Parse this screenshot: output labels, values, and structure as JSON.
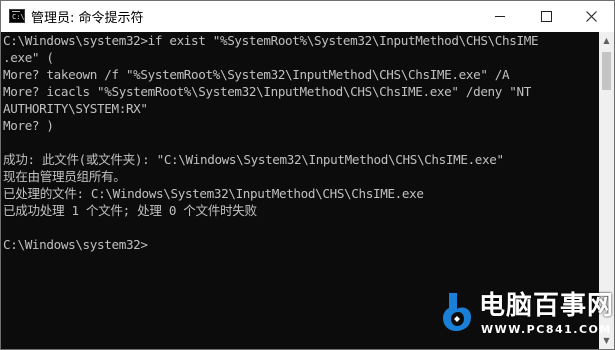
{
  "window": {
    "title": "管理员: 命令提示符",
    "icon_text": "C:\\_"
  },
  "controls": {
    "minimize_icon": "minimize-icon",
    "maximize_icon": "maximize-icon",
    "close_icon": "close-icon"
  },
  "console": {
    "lines": [
      "C:\\Windows\\system32>if exist \"%SystemRoot%\\System32\\InputMethod\\CHS\\ChsIME",
      ".exe\" (",
      "More? takeown /f \"%SystemRoot%\\System32\\InputMethod\\CHS\\ChsIME.exe\" /A",
      "More? icacls \"%SystemRoot%\\System32\\InputMethod\\CHS\\ChsIME.exe\" /deny \"NT",
      "AUTHORITY\\SYSTEM:RX\"",
      "More? )",
      "",
      "成功: 此文件(或文件夹): \"C:\\Windows\\System32\\InputMethod\\CHS\\ChsIME.exe\"",
      "现在由管理员组所有。",
      "已处理的文件: C:\\Windows\\System32\\InputMethod\\CHS\\ChsIME.exe",
      "已成功处理 1 个文件; 处理 0 个文件时失败",
      "",
      "C:\\Windows\\system32>"
    ],
    "text_color": "#c0c0c0",
    "background_color": "#0c0c0c"
  },
  "watermark": {
    "name": "电脑百事网",
    "url": "WWW.PC841.COM",
    "logo_color": "#1a7fd6"
  }
}
